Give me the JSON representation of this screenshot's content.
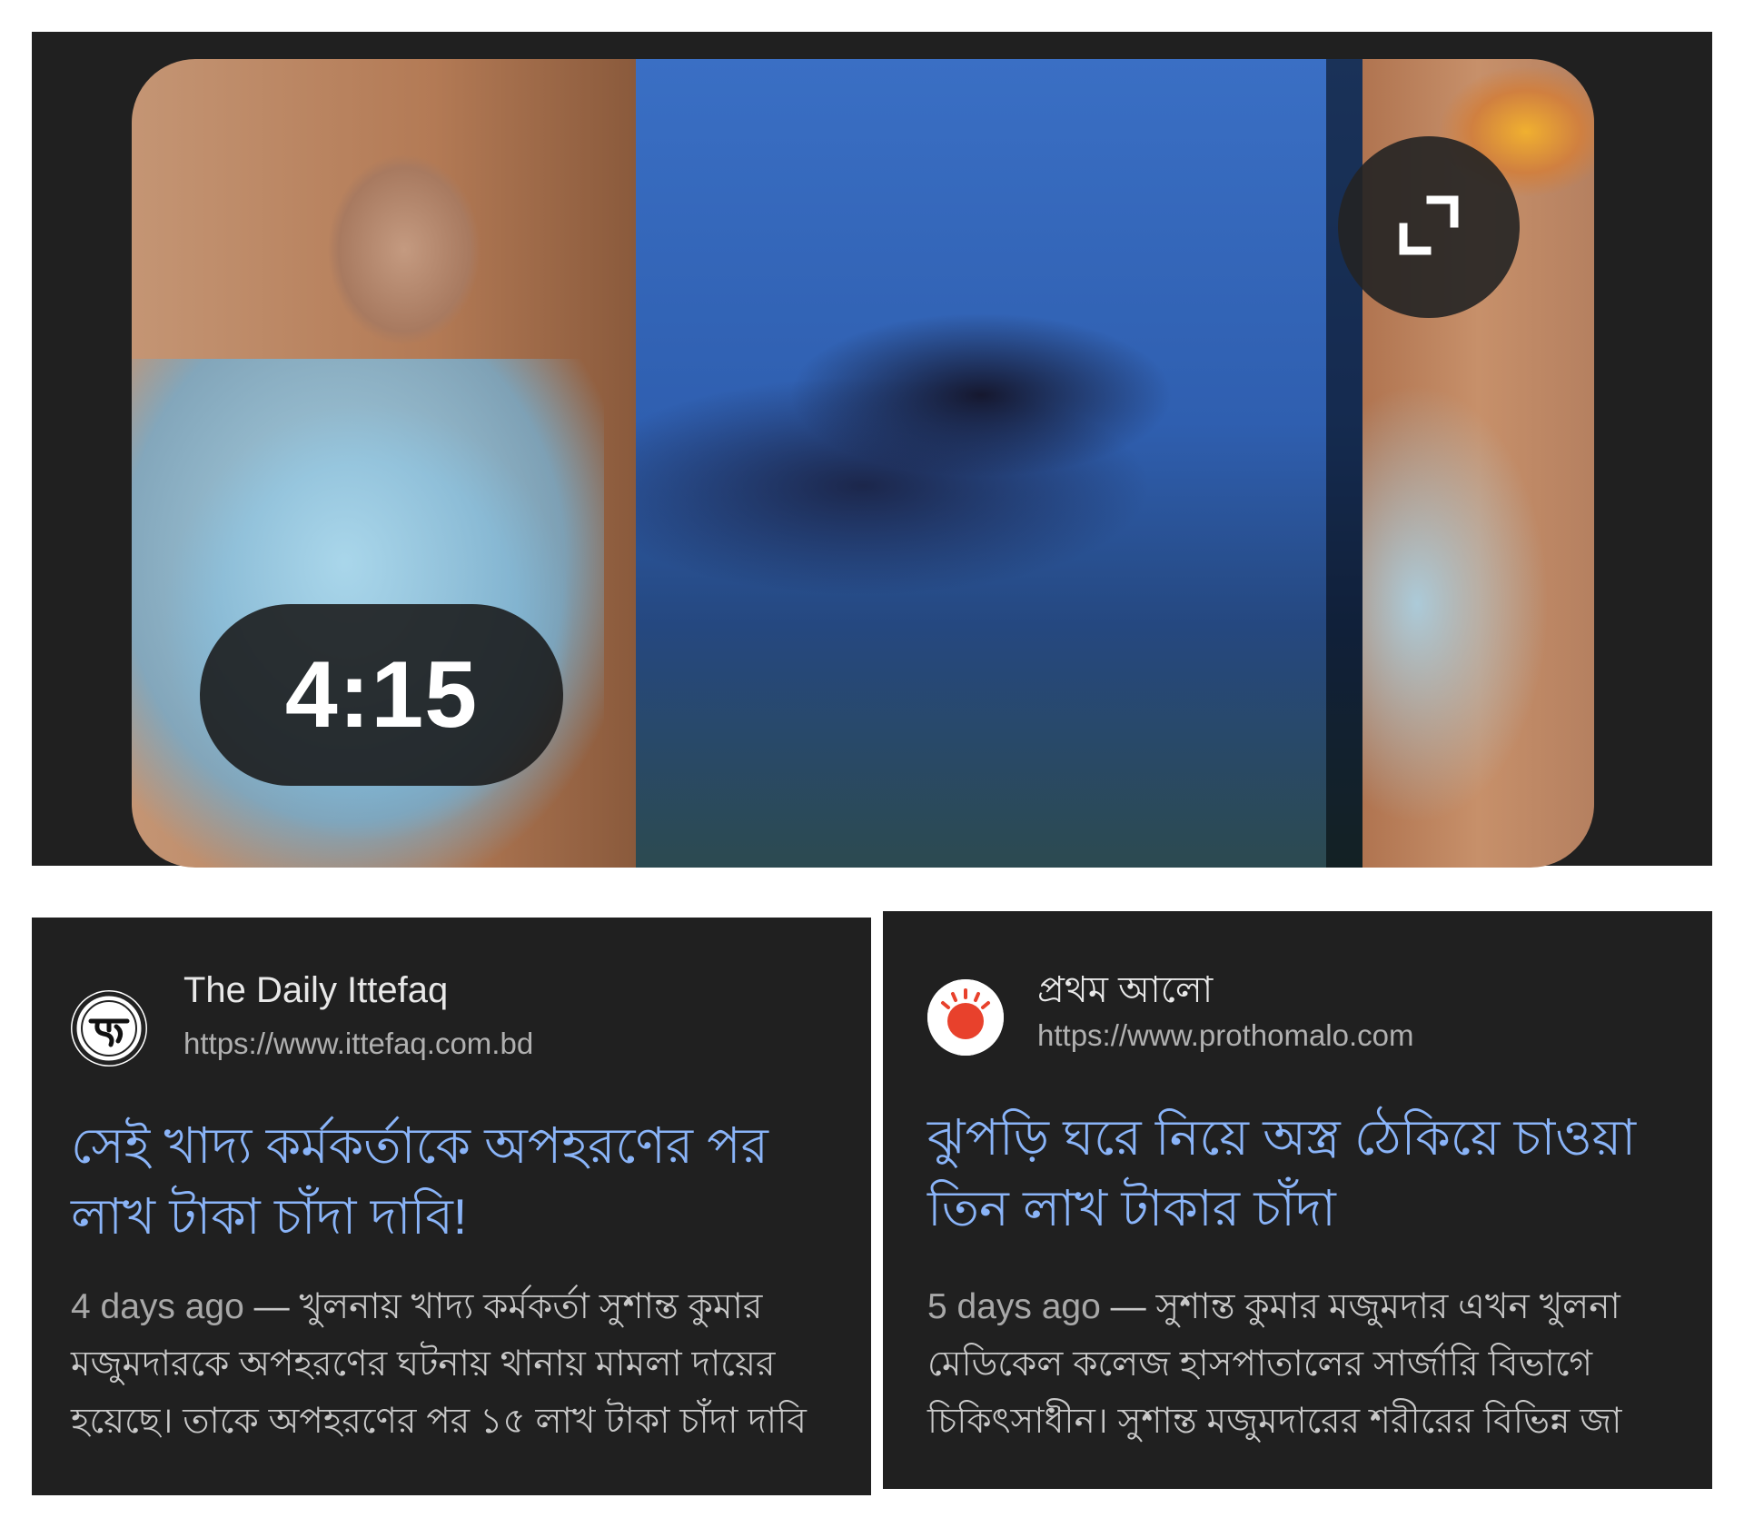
{
  "video": {
    "duration": "4:15",
    "expand_icon": "expand-icon"
  },
  "results": [
    {
      "source_name": "The Daily Ittefaq",
      "source_url": "https://www.ittefaq.com.bd",
      "logo_icon": "ittefaq-logo",
      "headline_line1": "সেই খাদ্য কর্মকর্তাকে অপহরণের পর",
      "headline_line2": "লাখ টাকা চাঁদা দাবি!",
      "age": "4 days ago",
      "snippet_line1": " — খুলনায় খাদ্য কর্মকর্তা সুশান্ত কুমার",
      "snippet_line2": "মজুমদারকে অপহরণের ঘটনায় থানায় মামলা দায়ের",
      "snippet_line3": "হয়েছে। তাকে অপহরণের পর ১৫ লাখ টাকা চাঁদা দাবি"
    },
    {
      "source_name": "প্রথম আলো",
      "source_url": "https://www.prothomalo.com",
      "logo_icon": "prothomalo-sun-logo",
      "headline_line1": "ঝুপড়ি ঘরে নিয়ে অস্ত্র ঠেকিয়ে চাওয়া",
      "headline_line2": "তিন লাখ টাকার চাঁদা",
      "age": "5 days ago",
      "snippet_line1": " — সুশান্ত কুমার মজুমদার এখন খুলনা",
      "snippet_line2": "মেডিকেল কলেজ হাসপাতালের সার্জারি বিভাগে",
      "snippet_line3": "চিকিৎসাধীন। সুশান্ত মজুমদারের শরীরের বিভিন্ন জা"
    }
  ],
  "colors": {
    "card_bg": "#202020",
    "headline": "#8ab4f8",
    "prothomalo_red": "#e8412c"
  }
}
